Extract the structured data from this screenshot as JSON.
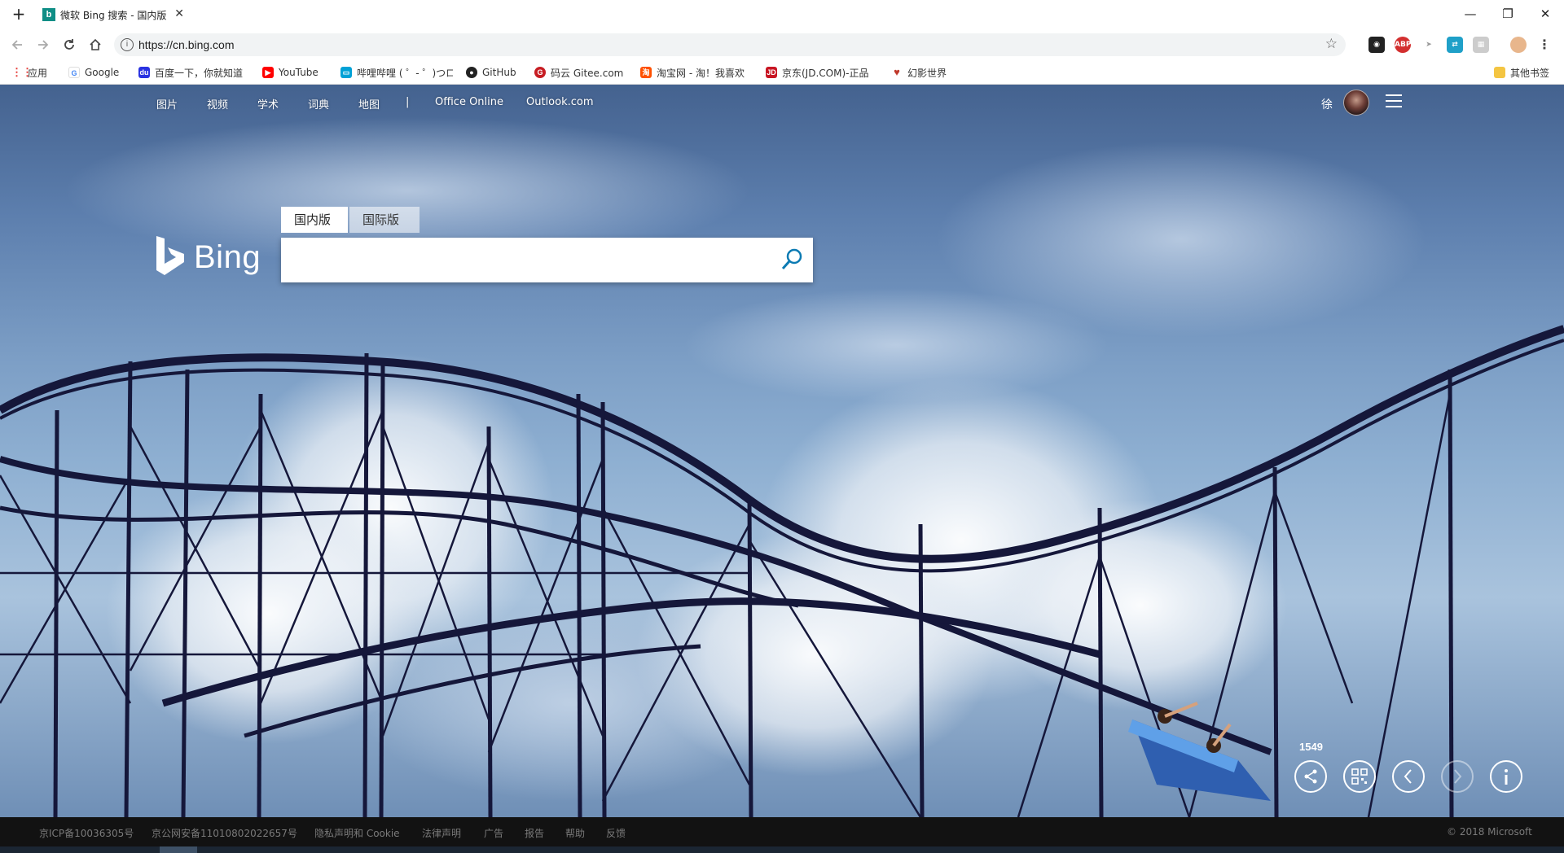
{
  "browser": {
    "tab_title": "微软 Bing 搜索 - 国内版",
    "favicon_letter": "b",
    "new_tab_glyph": "+",
    "close_glyph": "✕",
    "window_controls": {
      "minimize": "—",
      "restore": "❐",
      "close": "✕"
    },
    "url": "https://cn.bing.com",
    "info_glyph": "i",
    "bookmark_star": "☆"
  },
  "bookmarks": [
    {
      "label": "应用",
      "icon": "apps-icon",
      "color": "#e53935"
    },
    {
      "label": "Google",
      "icon": "google-icon",
      "color": "#4285f4"
    },
    {
      "label": "百度一下，你就知道",
      "icon": "baidu-icon",
      "color": "#2932e1"
    },
    {
      "label": "YouTube",
      "icon": "youtube-icon",
      "color": "#ff0000"
    },
    {
      "label": "哔哩哔哩 ( ゜- ゜)つロ",
      "icon": "bilibili-icon",
      "color": "#00a1d6"
    },
    {
      "label": "GitHub",
      "icon": "github-icon",
      "color": "#222222"
    },
    {
      "label": "码云 Gitee.com",
      "icon": "gitee-icon",
      "color": "#c71d23"
    },
    {
      "label": "淘宝网 - 淘！我喜欢",
      "icon": "taobao-icon",
      "color": "#ff5000"
    },
    {
      "label": "京东(JD.COM)-正品",
      "icon": "jd-icon",
      "color": "#c81623"
    },
    {
      "label": "幻影世界",
      "icon": "heart-icon",
      "color": "#2e7d32"
    },
    {
      "label": "其他书签",
      "icon": "folder-icon",
      "color": "#f4c542"
    }
  ],
  "bing": {
    "nav": [
      "图片",
      "视频",
      "学术",
      "词典",
      "地图",
      "|",
      "Office Online",
      "Outlook.com"
    ],
    "user_name": "徐",
    "logo_text": "Bing",
    "tabs": {
      "domestic": "国内版",
      "international": "国际版"
    },
    "search_value": "",
    "counter": "1549",
    "footer": {
      "links": [
        "京ICP备10036305号",
        "京公网安备11010802022657号",
        "隐私声明和 Cookie",
        "法律声明",
        "广告",
        "报告",
        "帮助",
        "反馈"
      ],
      "copyright": "© 2018 Microsoft"
    }
  },
  "colors": {
    "bing_teal": "#0f8e86",
    "search_icon": "#0c7bb3"
  }
}
